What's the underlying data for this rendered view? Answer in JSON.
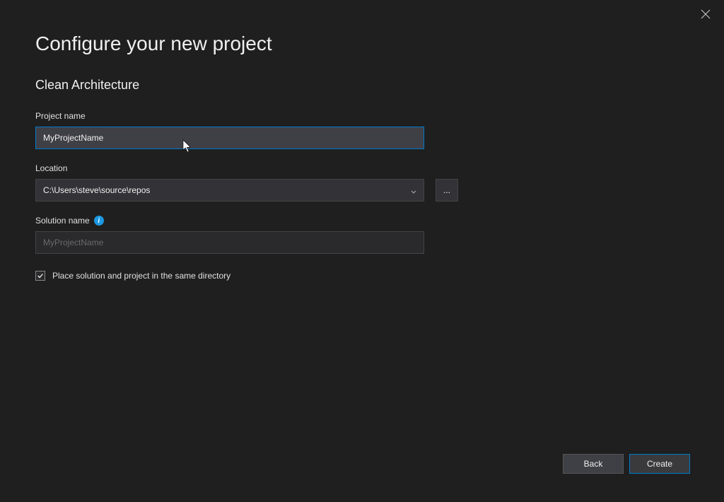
{
  "header": {
    "title": "Configure your new project",
    "template_name": "Clean Architecture"
  },
  "form": {
    "project_name_label": "Project name",
    "project_name_value": "MyProjectName",
    "location_label": "Location",
    "location_value": "C:\\Users\\steve\\source\\repos",
    "browse_label": "...",
    "solution_name_label": "Solution name",
    "solution_name_placeholder": "MyProjectName",
    "same_directory_label": "Place solution and project in the same directory",
    "same_directory_checked": true
  },
  "footer": {
    "back_label": "Back",
    "create_label": "Create"
  }
}
